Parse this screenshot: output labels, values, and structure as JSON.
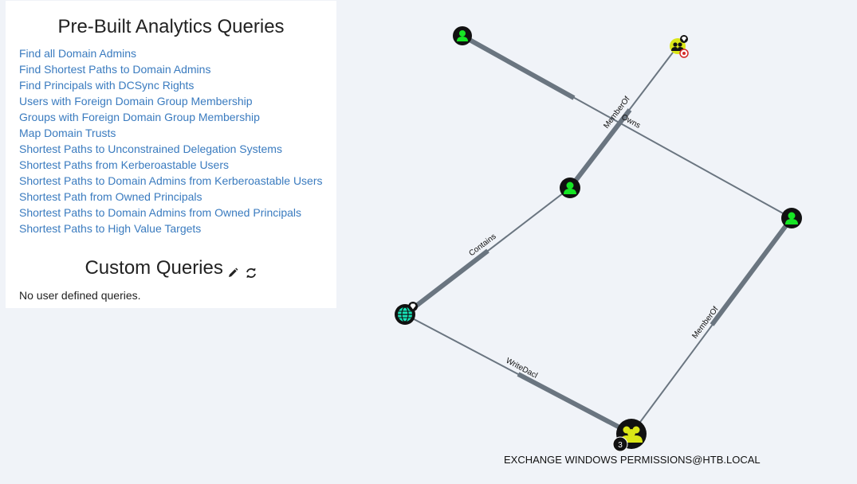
{
  "prebuilt": {
    "title": "Pre-Built Analytics Queries",
    "queries": [
      "Find all Domain Admins",
      "Find Shortest Paths to Domain Admins",
      "Find Principals with DCSync Rights",
      "Users with Foreign Domain Group Membership",
      "Groups with Foreign Domain Group Membership",
      "Map Domain Trusts",
      "Shortest Paths to Unconstrained Delegation Systems",
      "Shortest Paths from Kerberoastable Users",
      "Shortest Paths to Domain Admins from Kerberoastable Users",
      "Shortest Path from Owned Principals",
      "Shortest Paths to Domain Admins from Owned Principals",
      "Shortest Paths to High Value Targets"
    ]
  },
  "custom": {
    "title": "Custom Queries",
    "empty_text": "No user defined queries.",
    "icons": [
      "pencil-icon",
      "refresh-icon"
    ]
  },
  "graph": {
    "edges": {
      "memberof_1": "MemberOf",
      "owns": "Owns",
      "contains": "Contains",
      "writedacl": "WriteDacl",
      "memberof_2": "MemberOf"
    },
    "node_label": "EXCHANGE WINDOWS PERMISSIONS@HTB.LOCAL",
    "group_count": "3",
    "colors": {
      "user_node": "#17e625",
      "group_node": "#dbe617",
      "domain_node": "#17e6b9",
      "edge": "#6a7580",
      "link": "#3a7bbf"
    }
  }
}
